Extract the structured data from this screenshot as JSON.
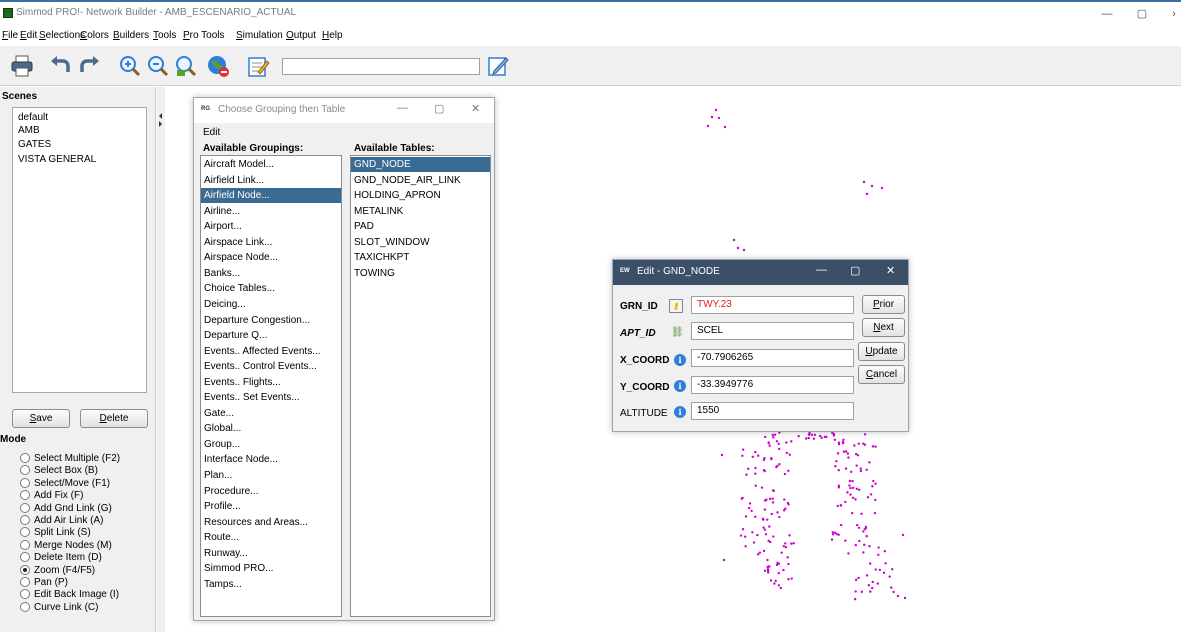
{
  "window": {
    "title": "Simmod PRO!- Network Builder - AMB_ESCENARIO_ACTUAL",
    "controls": [
      "—",
      "▢",
      "›"
    ]
  },
  "menu": [
    "File",
    "Edit",
    "Selections",
    "Colors",
    "Builders",
    "Tools",
    "Pro Tools",
    "Simulation",
    "Output",
    "Help"
  ],
  "toolbar": {
    "search_value": "",
    "icons": [
      "print-icon",
      "undo-icon",
      "redo-icon",
      "zoom-in-icon",
      "zoom-out-icon",
      "zoom-fit-icon",
      "globe-icon",
      "notepad-icon",
      "edit-pencil-icon"
    ]
  },
  "scenes": {
    "title": "Scenes",
    "items": [
      "default",
      "AMB",
      "GATES",
      "VISTA GENERAL"
    ],
    "save_label": "Save",
    "delete_label": "Delete"
  },
  "mode": {
    "title": "Mode",
    "items": [
      {
        "label": "Select Multiple (F2)",
        "checked": false
      },
      {
        "label": "Select Box (B)",
        "checked": false
      },
      {
        "label": "Select/Move (F1)",
        "checked": false
      },
      {
        "label": "Add Fix (F)",
        "checked": false
      },
      {
        "label": "Add Gnd Link (G)",
        "checked": false
      },
      {
        "label": "Add Air Link (A)",
        "checked": false
      },
      {
        "label": "Split Link (S)",
        "checked": false
      },
      {
        "label": "Merge Nodes (M)",
        "checked": false
      },
      {
        "label": "Delete Item (D)",
        "checked": false
      },
      {
        "label": "Zoom (F4/F5)",
        "checked": true
      },
      {
        "label": "Pan (P)",
        "checked": false
      },
      {
        "label": "Edit Back Image (I)",
        "checked": false
      },
      {
        "label": "Curve Link (C)",
        "checked": false
      }
    ]
  },
  "grouping_dialog": {
    "icon_text": "RG",
    "title": "Choose Grouping then Table",
    "menu": "Edit",
    "groupings_header": "Available Groupings:",
    "tables_header": "Available Tables:",
    "selected_grouping": "Airfield Node...",
    "selected_table": "GND_NODE",
    "groupings": [
      "Aircraft Model...",
      "Airfield Link...",
      "Airfield Node...",
      "Airline...",
      "Airport...",
      "Airspace Link...",
      "Airspace Node...",
      "Banks...",
      "Choice Tables...",
      "Deicing...",
      "Departure Congestion...",
      "Departure Q...",
      "Events.. Affected Events...",
      "Events.. Control Events...",
      "Events.. Flights...",
      "Events.. Set Events...",
      "Gate...",
      "Global...",
      "Group...",
      "Interface Node...",
      "Plan...",
      "Procedure...",
      "Profile...",
      "Resources and Areas...",
      "Route...",
      "Runway...",
      "Simmod PRO...",
      "Tamps..."
    ],
    "tables": [
      "GND_NODE",
      "GND_NODE_AIR_LINK",
      "HOLDING_APRON",
      "METALINK",
      "PAD",
      "SLOT_WINDOW",
      "TAXICHKPT",
      "TOWING"
    ]
  },
  "edit_dialog": {
    "icon_text": "EW",
    "title": "Edit - GND_NODE",
    "fields": [
      {
        "label": "GRN_ID",
        "value": "TWY.23"
      },
      {
        "label": "APT_ID",
        "value": "SCEL"
      },
      {
        "label": "X_COORD",
        "value": "-70.7906265"
      },
      {
        "label": "Y_COORD",
        "value": "-33.3949776"
      },
      {
        "label": "ALTITUDE",
        "value": "1550"
      }
    ],
    "buttons": {
      "prior": "Prior",
      "next": "Next",
      "update": "Update",
      "cancel": "Cancel"
    }
  },
  "colors": {
    "node": "#cc00cc",
    "selection": "#3a6b93",
    "dark_title": "#3c4f69"
  }
}
